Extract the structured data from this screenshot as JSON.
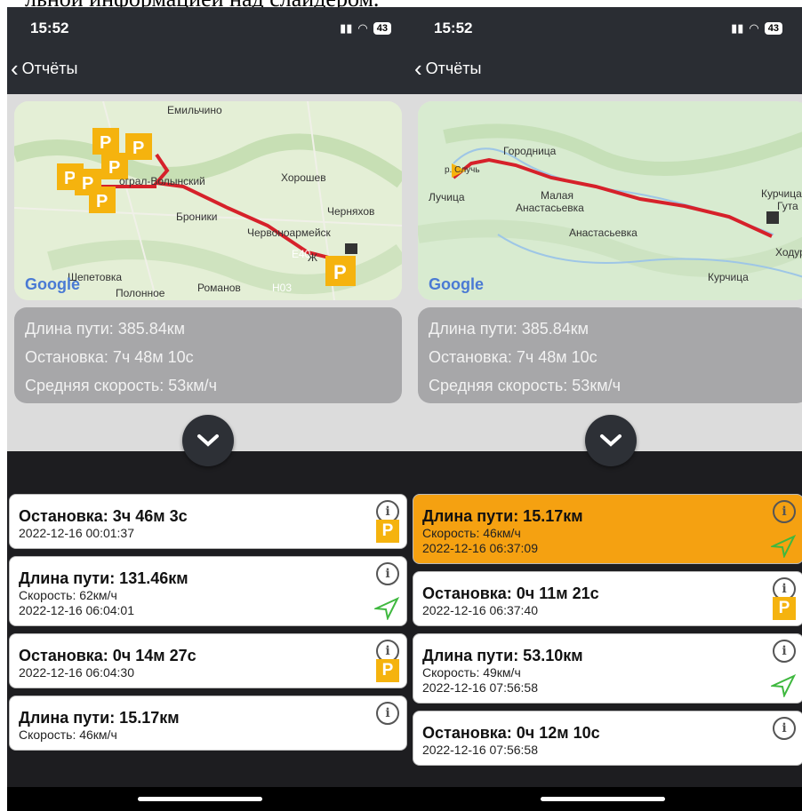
{
  "caption": "льной информацией над слайдером.",
  "status": {
    "time": "15:52",
    "battery": "43"
  },
  "nav": {
    "back_label": "Отчёты"
  },
  "stats": {
    "length": "Длина пути: 385.84км",
    "stop": "Остановка: 7ч 48м 10с",
    "avg_speed": "Средняя скорость: 53км/ч"
  },
  "map_left": {
    "google": "Google",
    "labels": [
      "Емильчино",
      "Новоград-Волынский",
      "Хорошев",
      "Броники",
      "Черняхов",
      "Червоноармейск",
      "Житомир",
      "Шепетовка",
      "Полонное",
      "Романов",
      "E40",
      "H03"
    ]
  },
  "map_right": {
    "google": "Google",
    "labels": [
      "Городница",
      "Лучица",
      "Малая",
      "Анастасьевка",
      "Анастасьевка",
      "Курчица",
      "Гута",
      "Ходур",
      "Курчица",
      "р. Случь"
    ]
  },
  "left_cards": [
    {
      "title": "Остановка: 3ч 46м 3с",
      "date": "2022-12-16 00:01:37",
      "type": "stop"
    },
    {
      "title": "Длина пути: 131.46км",
      "speed": "Скорость: 62км/ч",
      "date": "2022-12-16 06:04:01",
      "type": "trip"
    },
    {
      "title": "Остановка: 0ч 14м 27с",
      "date": "2022-12-16 06:04:30",
      "type": "stop"
    },
    {
      "title": "Длина пути: 15.17км",
      "speed": "Скорость: 46км/ч",
      "type": "trip"
    }
  ],
  "right_cards": [
    {
      "title": "Длина пути: 15.17км",
      "speed": "Скорость: 46км/ч",
      "date": "2022-12-16 06:37:09",
      "type": "trip"
    },
    {
      "title": "Остановка: 0ч 11м 21с",
      "date": "2022-12-16 06:37:40",
      "type": "stop"
    },
    {
      "title": "Длина пути: 53.10км",
      "speed": "Скорость: 49км/ч",
      "date": "2022-12-16 07:56:58",
      "type": "trip"
    },
    {
      "title": "Остановка: 0ч 12м 10с",
      "date": "2022-12-16 07:56:58",
      "type": "stop"
    }
  ],
  "icons": {
    "info": "i",
    "parking": "P"
  },
  "colors": {
    "accent": "#f5a111",
    "route": "#d6212a",
    "parking": "#f5b30e"
  }
}
